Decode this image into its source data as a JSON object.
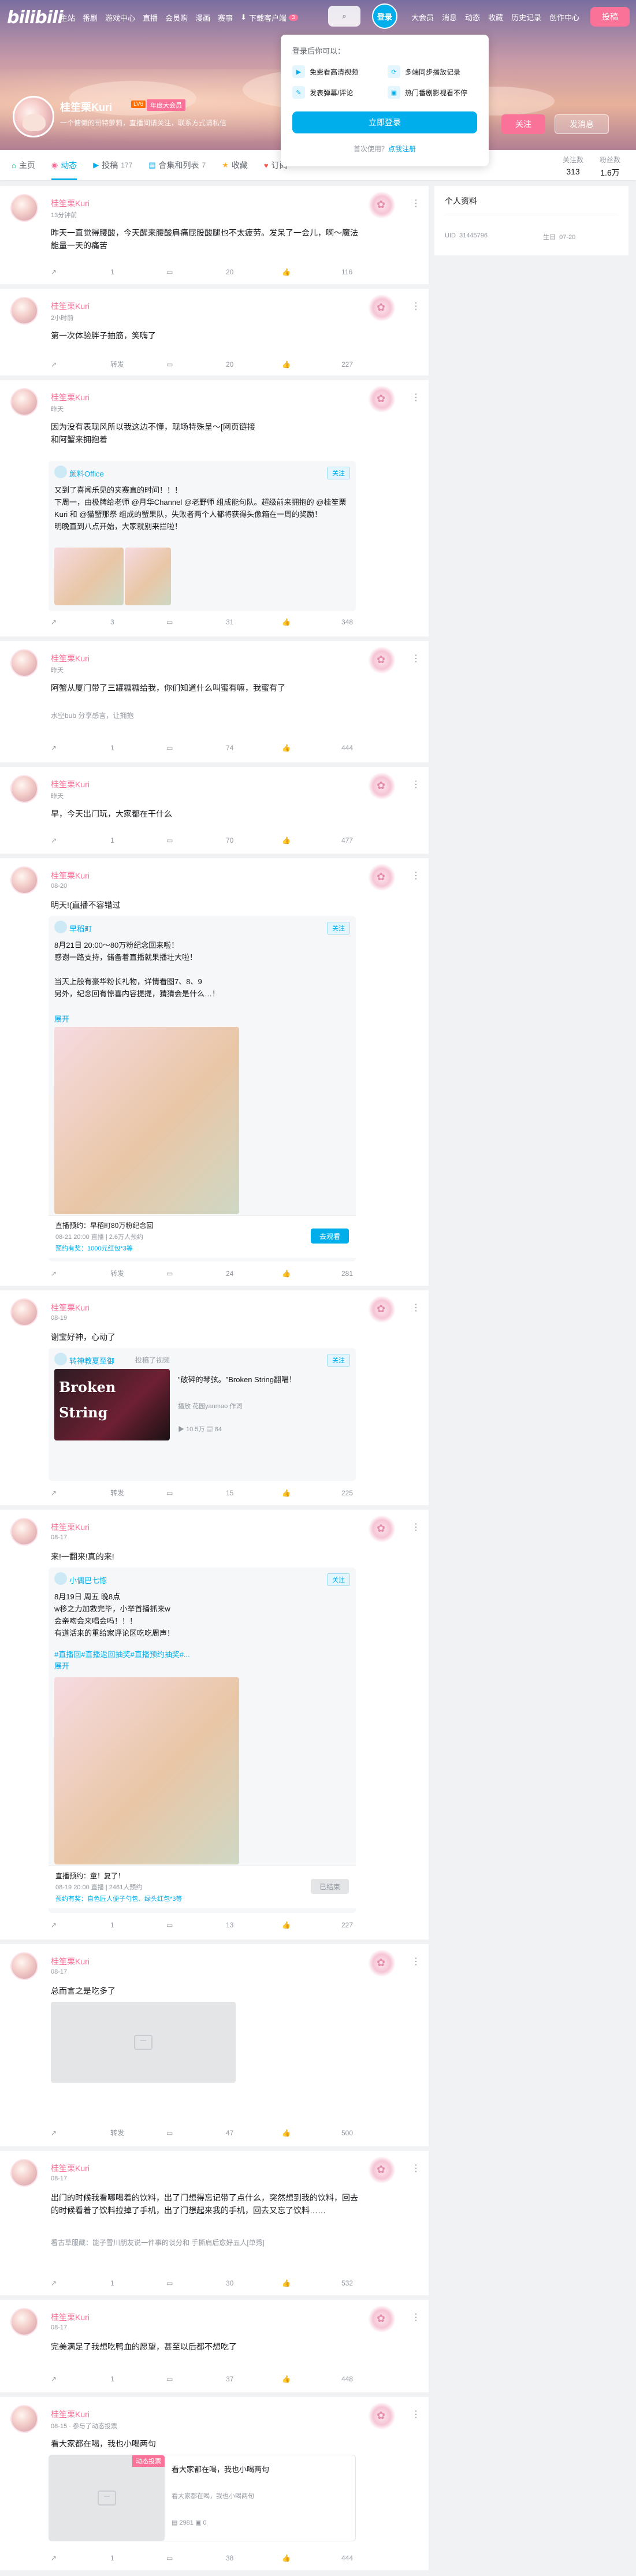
{
  "header": {
    "logo": "bilibili",
    "nav": [
      "主站",
      "番剧",
      "游戏中心",
      "直播",
      "会员购",
      "漫画",
      "赛事"
    ],
    "download": "下载客户端",
    "download_badge": "3",
    "login_label": "登录",
    "right_nav": [
      "大会员",
      "消息",
      "动态",
      "收藏",
      "历史记录",
      "创作中心"
    ],
    "upload": "投稿"
  },
  "profile": {
    "name": "桂笙栗Kuri",
    "level": "LV6",
    "vip": "年度大会员",
    "sign": "一个慵懒的哥特萝莉，直播间请关注，联系方式请私信",
    "follow": "关注",
    "message": "发消息"
  },
  "tabs": [
    {
      "label": "主页",
      "count": "",
      "icon": "home-icon"
    },
    {
      "label": "动态",
      "count": "",
      "icon": "dynamic-icon"
    },
    {
      "label": "投稿",
      "count": "177",
      "icon": "video-icon"
    },
    {
      "label": "合集和列表",
      "count": "7",
      "icon": "collection-icon"
    },
    {
      "label": "收藏",
      "count": "",
      "icon": "star-icon"
    },
    {
      "label": "订阅",
      "count": "",
      "icon": "heart-icon"
    }
  ],
  "stats": [
    {
      "label": "关注数",
      "value": "313"
    },
    {
      "label": "粉丝数",
      "value": "1.6万"
    }
  ],
  "popup": {
    "title": "登录后你可以：",
    "perks": [
      "免费看高清视频",
      "多端同步播放记录",
      "发表弹幕/评论",
      "热门番剧影视看不停"
    ],
    "login_now": "立即登录",
    "first_use": "首次使用？",
    "register": "点我注册"
  },
  "right_panel": {
    "title": "个人资料",
    "uid_label": "UID",
    "uid": "31445796",
    "birthday_label": "生日",
    "birthday": "07-20"
  },
  "posts": [
    {
      "user": "桂笙栗Kuri",
      "time": "13分钟前",
      "text": "昨天一直觉得腰酸，今天醒来腰酸肩痛屁股酸腿也不太疲劳。发呆了一会儿，啊～魔法能量一天的痛苦",
      "repost": "1",
      "comment": "20",
      "like": "116"
    },
    {
      "user": "桂笙栗Kuri",
      "time": "2小时前",
      "text": "第一次体验胖子抽筋，笑嗨了",
      "repost": "转发",
      "comment": "20",
      "like": "227"
    },
    {
      "user": "桂笙栗Kuri",
      "time": "昨天",
      "text": "因为没有表现风所以我这边不懂，现场特殊呈～[网页链接",
      "text2": "和阿蟹来拥抱着",
      "repost_user": "颜料Office",
      "repost_follow": "关注",
      "repost_text": "又到了喜闻乐见的夹赛直的时间！！！\n下周一，由极牌给老师 @月华Channel @老野师 组成能句队。超级前来拥抱的 @桂笙栗Kuri 和 @猫蟹那祭 组成的蟹果队，失败者两个人都将获得头像箱在一周的奖励！\n明晚直到八点开始，大家就别来拦啦！",
      "repost": "3",
      "comment": "31",
      "like": "348"
    },
    {
      "user": "桂笙栗Kuri",
      "time": "昨天",
      "text": "阿蟹从厦门带了三罐糖糖给我，你们知道什么叫蜜有嘛，我蜜有了",
      "tag": "水空bub 分享感言，让拥抱",
      "repost": "1",
      "comment": "74",
      "like": "444"
    },
    {
      "user": "桂笙栗Kuri",
      "time": "昨天",
      "text": "早，今天出门玩，大家都在干什么",
      "repost": "1",
      "comment": "70",
      "like": "477"
    },
    {
      "user": "桂笙栗Kuri",
      "time": "08-20",
      "text": "明天!(直播不容错过",
      "repost_user": "早稻町",
      "repost_follow": "关注",
      "repost_text": "8月21日 20:00～80万粉纪念回来啦！\n感谢一路支持，储备着直播就果播壮大啦！\n\n当天上般有豪华粉长礼物，详情看图7、8、9\n另外，纪念回有惊喜内容提提，猜猜会是什么…！",
      "expand": "展开",
      "live_title": "直播预约：早稻町80万粉纪念回",
      "live_sub": "08-21 20:00 直播 | 2.6万人预约",
      "live_gift": "预约有奖：1000元红包*3等",
      "live_btn": "去观看",
      "repost": "转发",
      "comment": "24",
      "like": "281"
    },
    {
      "user": "桂笙栗Kuri",
      "time": "08-19",
      "text": "谢宝好神，心动了",
      "repost_user": "转神教夏至御",
      "repost_meta": "投稿了视频",
      "repost_follow": "关注",
      "video_title": "\"破碎的琴弦。\"Broken String翻唱！",
      "video_meta": "播放 花园yanmao 作词",
      "video_views": "10.5万",
      "video_danmaku": "84",
      "video_cover_text": "Broken\nString",
      "repost": "转发",
      "comment": "15",
      "like": "225"
    },
    {
      "user": "桂笙栗Kuri",
      "time": "08-17",
      "text": "来!一翻来!真的来!",
      "repost_user": "小偶巴七惚",
      "repost_follow": "关注",
      "repost_text": "8月19日 周五 晚8点\nw移之力加救完毕，小举首播抓来w\n会亲吻会来唱会吗！！！\n有道活来的重给家评论区吃吃周声！",
      "hashtags": "#直播回#直播返回抽奖#直播预约抽奖#...",
      "expand": "展开",
      "live_title": "直播预约：童！复了！",
      "live_sub": "08-19 20:00 直播 | 2461人预约",
      "live_gift": "预约有奖：自色匠人便子勺包、绿头红包*3等",
      "live_btn": "已结束",
      "repost": "1",
      "comment": "13",
      "like": "227"
    },
    {
      "user": "桂笙栗Kuri",
      "time": "08-17",
      "text": "总而言之是吃多了",
      "repost": "转发",
      "comment": "47",
      "like": "500"
    },
    {
      "user": "桂笙栗Kuri",
      "time": "08-17",
      "text": "出门的时候我看哪喝着的饮料，出了门想得忘记带了点什么，突然想到我的饮料，回去的时候看着了饮料拉掉了手机，出了门想起来我的手机，回去又忘了饮料……",
      "tag": "看古草服藏：能子雪川朋友说一件事的谈分和 手撕肩后愈好五人[单秀]",
      "repost": "1",
      "comment": "30",
      "like": "532"
    },
    {
      "user": "桂笙栗Kuri",
      "time": "08-17",
      "text": "完美满足了我想吃鸭血的愿望，甚至以后都不想吃了",
      "repost": "1",
      "comment": "37",
      "like": "448"
    },
    {
      "user": "桂笙栗Kuri",
      "time": "08-15 · 参与了动态投票",
      "text": "看大家都在喝，我也小喝两句",
      "vote_badge": "动态投票",
      "vote_title": "看大家都在喝，我也小喝两句",
      "vote_sub": "看大家都在喝，我也小喝两句",
      "vote_count": "2981",
      "vote_c2": "0",
      "repost": "1",
      "comment": "38",
      "like": "444"
    }
  ]
}
